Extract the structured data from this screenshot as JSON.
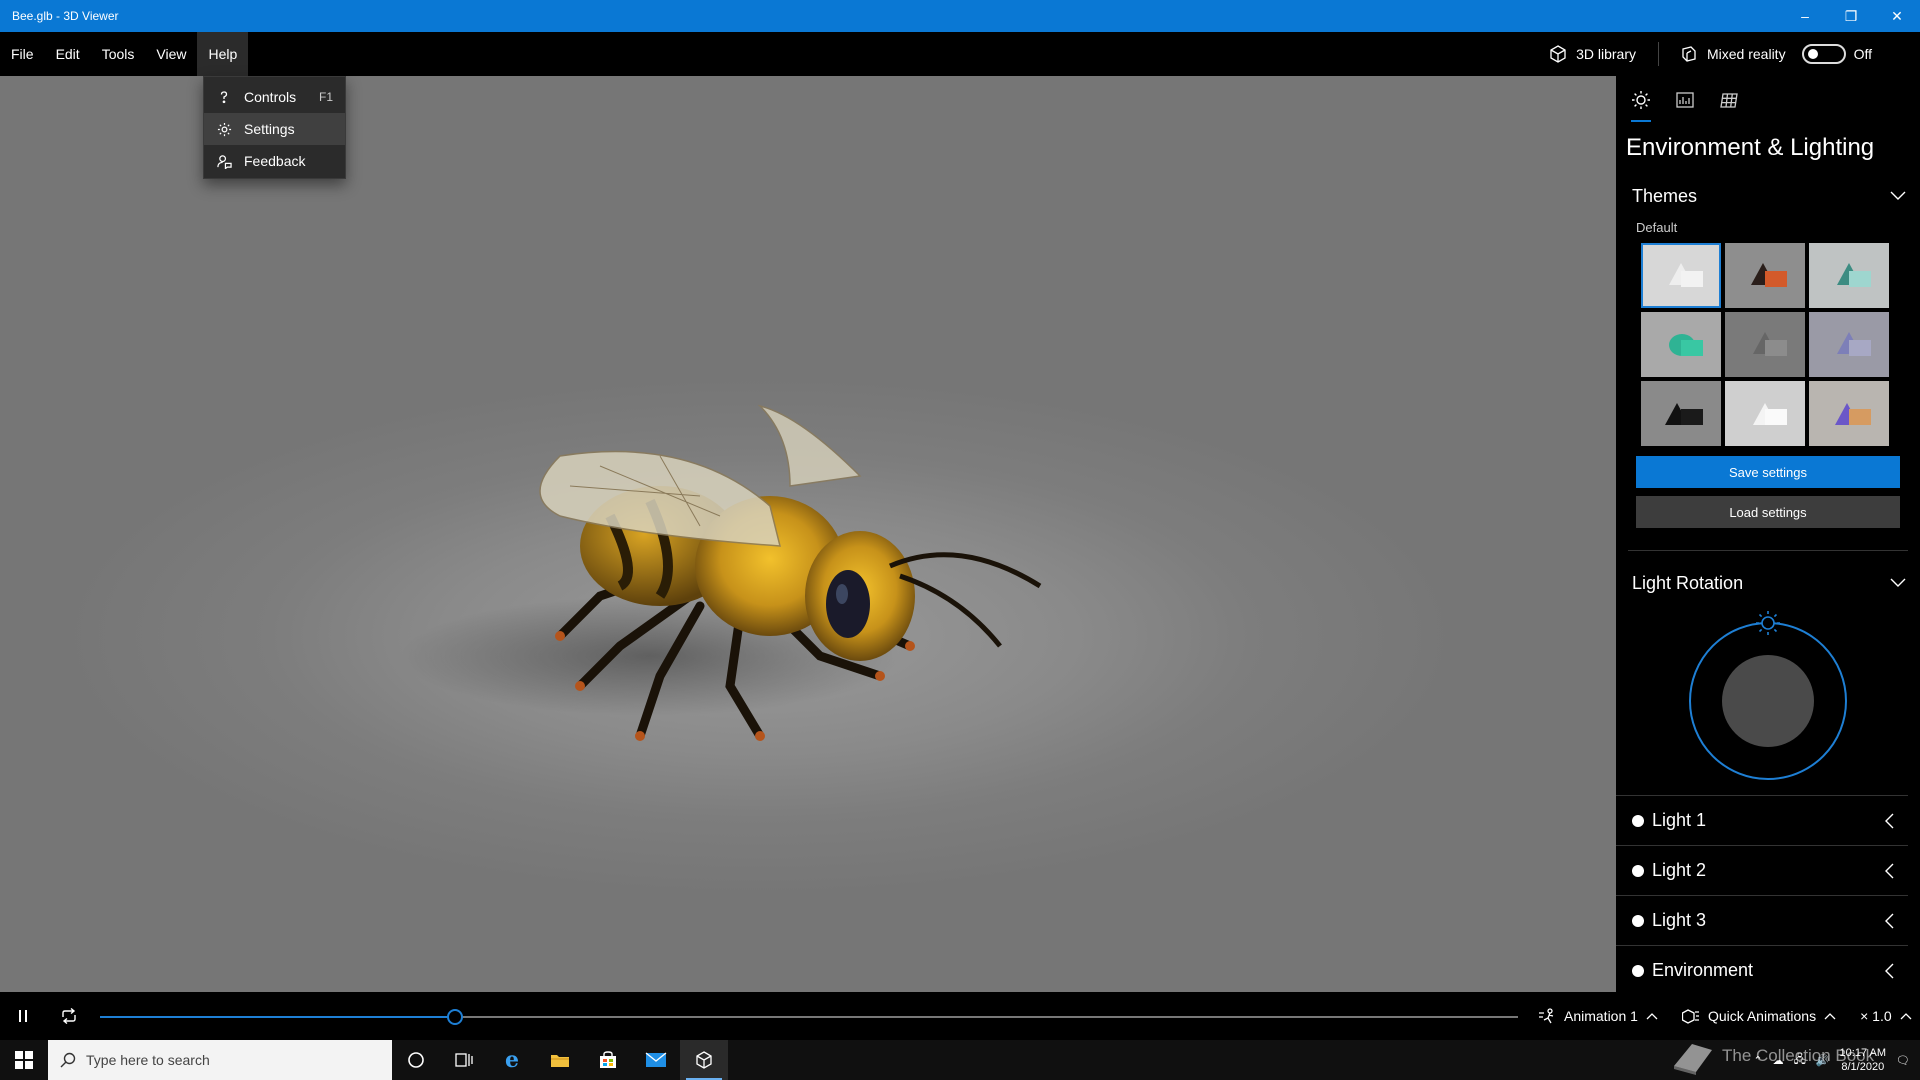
{
  "window": {
    "title": "Bee.glb - 3D Viewer",
    "minimize": "–",
    "maximize": "❐",
    "close": "✕"
  },
  "menu": {
    "items": [
      "File",
      "Edit",
      "Tools",
      "View",
      "Help"
    ],
    "library_label": "3D library",
    "mixed_reality_label": "Mixed reality",
    "mixed_reality_state": "Off"
  },
  "help_menu": {
    "items": [
      {
        "label": "Controls",
        "shortcut": "F1",
        "icon": "question-icon"
      },
      {
        "label": "Settings",
        "shortcut": "",
        "icon": "gear-icon"
      },
      {
        "label": "Feedback",
        "shortcut": "",
        "icon": "feedback-icon"
      }
    ]
  },
  "panel": {
    "title": "Environment & Lighting",
    "themes_label": "Themes",
    "themes_sub": "Default",
    "save_label": "Save settings",
    "load_label": "Load settings",
    "light_rotation_label": "Light Rotation",
    "lights": [
      "Light 1",
      "Light 2",
      "Light 3",
      "Environment"
    ]
  },
  "animation": {
    "progress": 0.25,
    "name": "Animation 1",
    "quick_label": "Quick Animations",
    "speed": "× 1.0"
  },
  "taskbar": {
    "search_placeholder": "Type here to search",
    "time": "10:17 AM",
    "date": "8/1/2020"
  },
  "watermark": "The Collection Book",
  "colors": {
    "accent": "#0a78d4",
    "panel_bg": "#000000",
    "viewport": "#8a8a8a"
  }
}
